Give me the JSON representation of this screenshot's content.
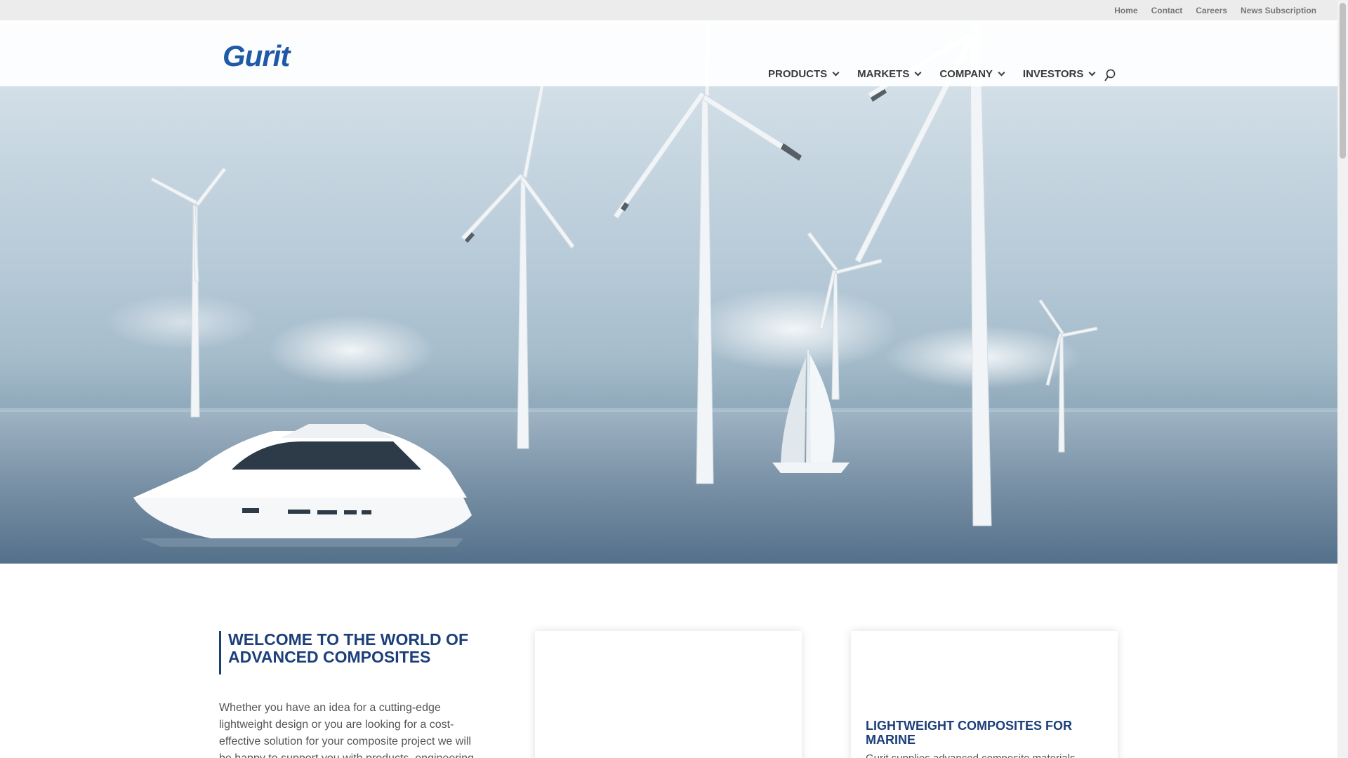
{
  "topbar": {
    "links": [
      "Home",
      "Contact",
      "Careers",
      "News Subscription"
    ]
  },
  "header": {
    "logo_text": "Gurit",
    "nav": [
      {
        "label": "PRODUCTS"
      },
      {
        "label": "MARKETS"
      },
      {
        "label": "COMPANY"
      },
      {
        "label": "INVESTORS"
      }
    ],
    "search_icon": "search-icon"
  },
  "hero": {
    "scene": "offshore-wind-turbines-yacht-sailboat"
  },
  "welcome": {
    "title": "WELCOME TO THE WORLD OF ADVANCED COMPOSITES",
    "text": "Whether you have an idea for a cutting-edge lightweight design or you are looking for a cost-effective solution for your composite project we will be happy to support you with products, engineering"
  },
  "cards": [
    {
      "title": ""
    },
    {
      "title": "LIGHTWEIGHT COMPOSITES FOR MARINE",
      "text": "Gurit supplies advanced composite materials"
    }
  ],
  "colors": {
    "brand_blue": "#1f5aa6",
    "heading_navy": "#1c3f7a",
    "topbar_bg": "#ececec"
  }
}
